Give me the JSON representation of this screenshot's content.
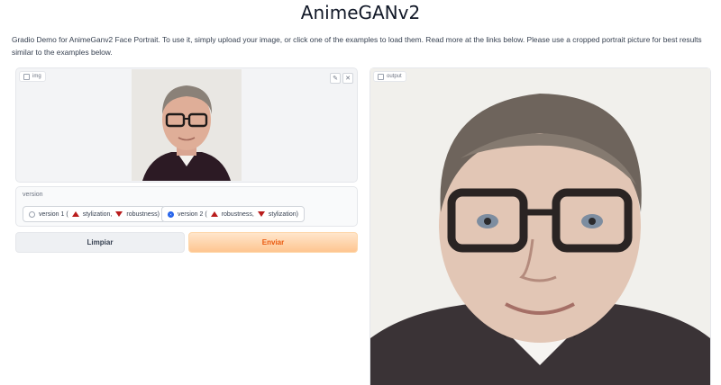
{
  "app": {
    "title": "AnimeGANv2",
    "description": "Gradio Demo for AnimeGanv2 Face Portrait. To use it, simply upload your image, or click one of the examples to load them. Read more at the links below. Please use a cropped portrait picture for best results similar to the examples below."
  },
  "input_panel": {
    "label": "img",
    "edit_icon": "pencil-icon",
    "close_icon": "close-icon"
  },
  "version": {
    "label": "version",
    "options": [
      {
        "prefix": "version 1 (",
        "up": "stylization,",
        "down": "robustness)",
        "selected": false
      },
      {
        "prefix": "version 2 (",
        "up": "robustness,",
        "down": "stylization)",
        "selected": true
      }
    ]
  },
  "buttons": {
    "clear": "Limpiar",
    "submit": "Enviar"
  },
  "output_panel": {
    "label": "output"
  },
  "colors": {
    "accent": "#ea580c",
    "radio_selected": "#2563eb",
    "arrow": "#b91c1c"
  }
}
